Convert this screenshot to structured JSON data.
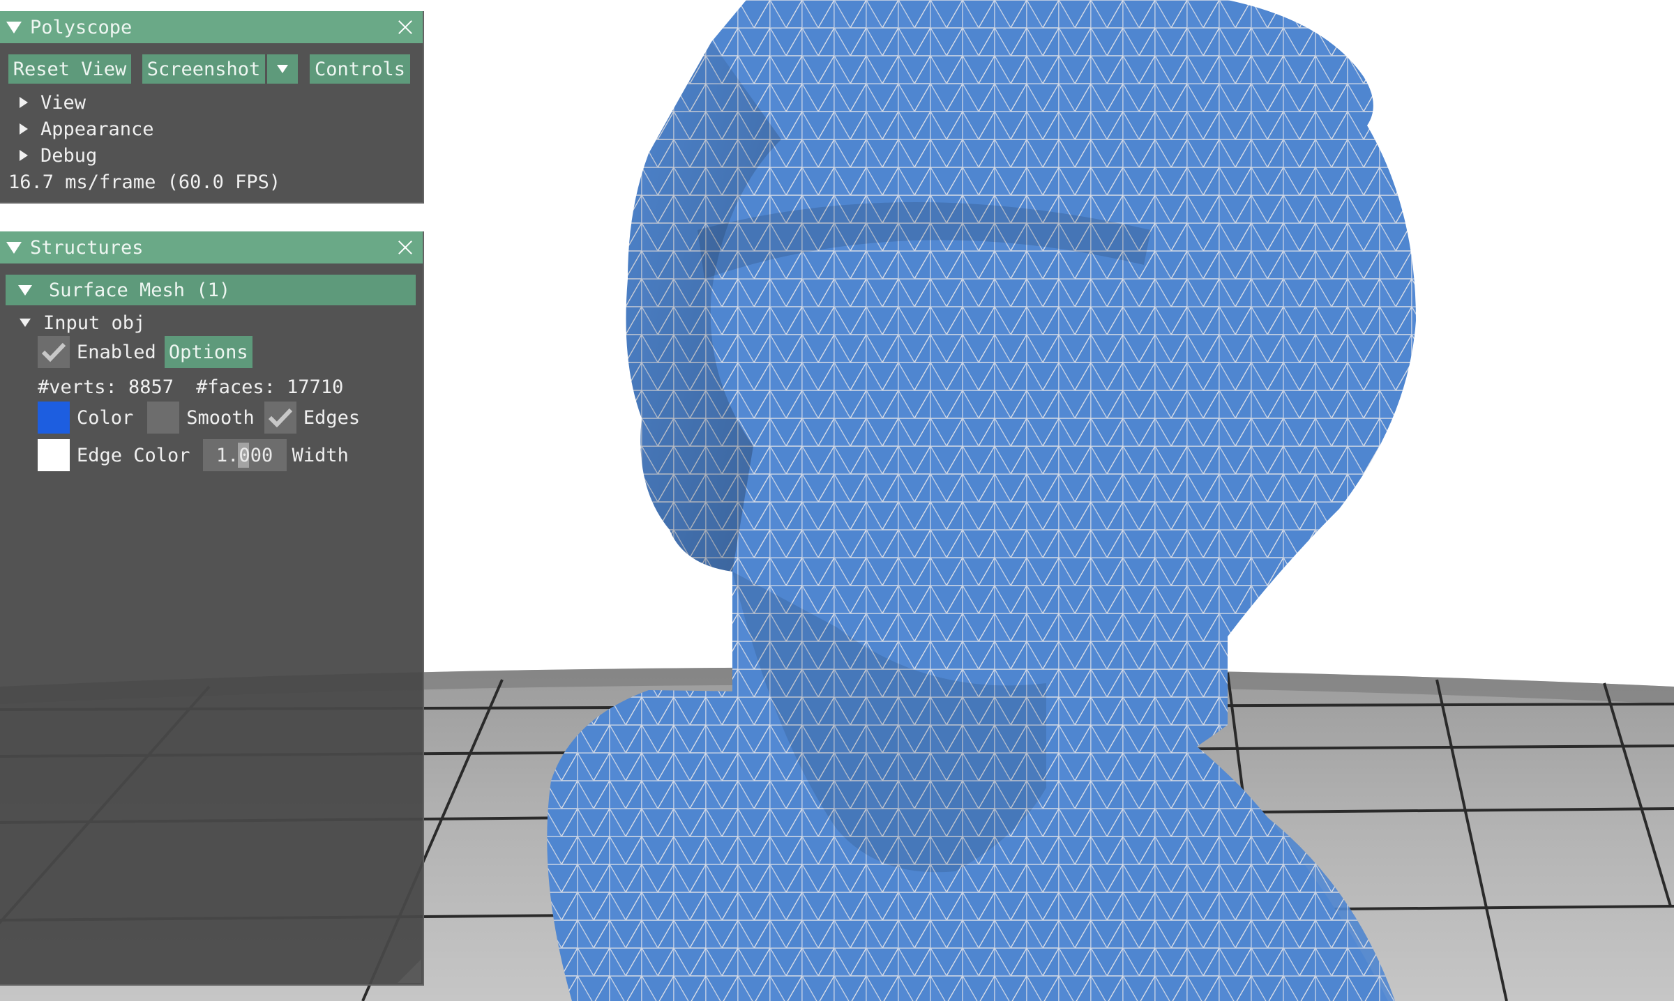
{
  "colors": {
    "mesh": "#4f86d0",
    "mesh_edges": "#d9dde6",
    "ground": "#a8a8a8",
    "panel_title": "#6aa987",
    "button": "#5e9a7b"
  },
  "polyscope": {
    "title": "Polyscope",
    "buttons": {
      "reset_view": "Reset View",
      "screenshot": "Screenshot",
      "controls": "Controls"
    },
    "tree": {
      "view": "View",
      "appearance": "Appearance",
      "debug": "Debug"
    },
    "fps": "16.7 ms/frame (60.0 FPS)"
  },
  "structures": {
    "title": "Structures",
    "group_header": "Surface Mesh (1)",
    "item": {
      "name": "Input obj",
      "enabled": true,
      "enabled_label": "Enabled",
      "options_label": "Options",
      "verts_text": "#verts: 8857",
      "faces_text": "#faces: 17710",
      "color_label": "Color",
      "color_value": "#1d5ee0",
      "smooth": false,
      "smooth_label": "Smooth",
      "edges": true,
      "edges_label": "Edges",
      "edge_color_label": "Edge Color",
      "edge_color_value": "#ffffff",
      "edge_width_value": "1.000",
      "width_label": "Width"
    }
  }
}
